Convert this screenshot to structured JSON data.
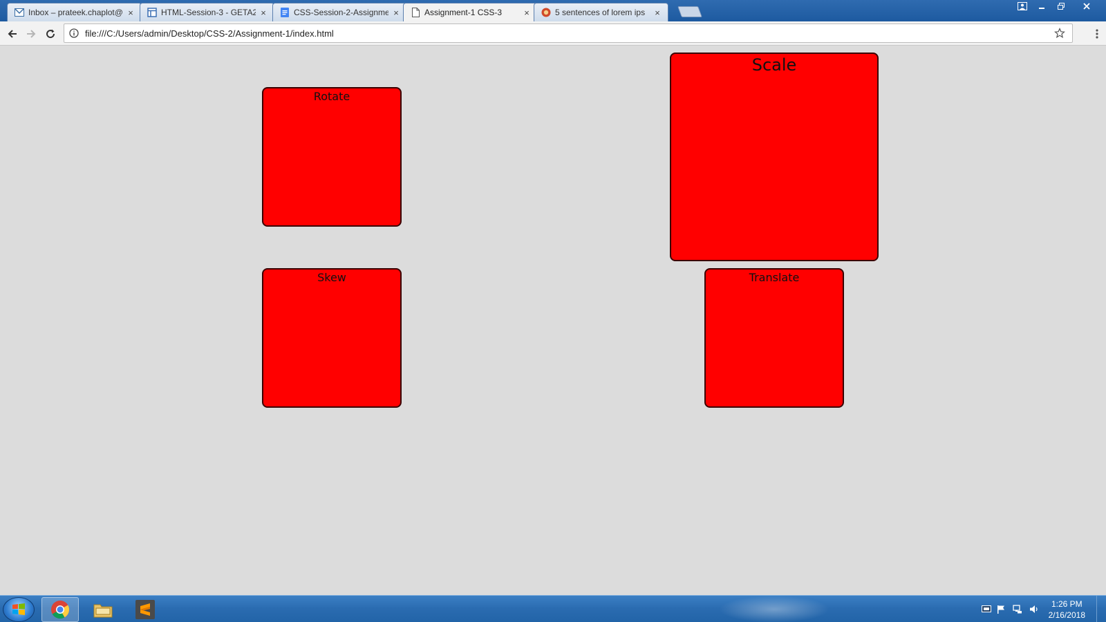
{
  "browser": {
    "tabs": [
      {
        "title": "Inbox – prateek.chaplot@",
        "icon": "gmail-icon",
        "active": false
      },
      {
        "title": "HTML-Session-3 - GETA2",
        "icon": "doc-layout-icon",
        "active": false
      },
      {
        "title": "CSS-Session-2-Assignme",
        "icon": "google-docs-icon",
        "active": false
      },
      {
        "title": "Assignment-1 CSS-3",
        "icon": "page-icon",
        "active": true
      },
      {
        "title": "5 sentences of lorem ips",
        "icon": "lorem-site-icon",
        "active": false
      }
    ],
    "close_glyph": "×",
    "url": "file:///C:/Users/admin/Desktop/CSS-2/Assignment-1/index.html"
  },
  "page": {
    "boxes": {
      "rotate": "Rotate",
      "scale": "Scale",
      "skew": "Skew",
      "translate": "Translate"
    },
    "box_color": "#ff0000"
  },
  "taskbar": {
    "apps": [
      "chrome-icon",
      "file-explorer-icon",
      "sublime-text-icon"
    ],
    "time": "1:26 PM",
    "date": "2/16/2018"
  }
}
